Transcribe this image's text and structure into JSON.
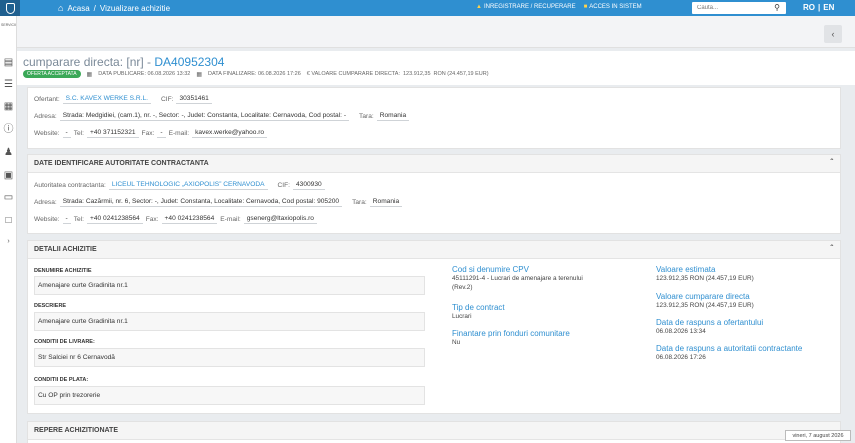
{
  "topbar": {
    "breadcrumb": [
      "Acasa",
      "/",
      "Vizualizare achizitie"
    ],
    "links": [
      "INREGISTRARE / RECUPERARE",
      "ACCES IN SISTEM"
    ],
    "search_placeholder": "Cauta...",
    "lang": [
      "RO",
      "|",
      "EN"
    ]
  },
  "sidebar": {
    "label": "SERVICII"
  },
  "header": {
    "title_prefix": "cumparare directa: [nr] -",
    "code": "DA40952304",
    "status": "OFERTA ACCEPTATA",
    "publish": "DATA PUBLICARE: 06.08.2026 13:32",
    "finalize": "DATA FINALIZARE: 06.08.2026 17:26",
    "value_label": "€ VALOARE CUMPARARE DIRECTA:",
    "value": "123.912,35",
    "value_unit": "RON (24.457,19 EUR)"
  },
  "ofertant": {
    "label": "Ofertant:",
    "name": "S.C. KAVEX WERKE S.R.L.",
    "cif_label": "CIF:",
    "cif": "30351461",
    "address_label": "Adresa:",
    "address": "Strada: Medgidiei, (cam.1), nr. -, Sector: -, Judet: Constanta, Localitate: Cernavoda, Cod postal: -",
    "country_label": "Tara:",
    "country": "Romania",
    "website_label": "Website:",
    "website": "-",
    "tel_label": "Tel:",
    "tel": "+40 371152321",
    "fax_label": "Fax:",
    "fax": "-",
    "email_label": "E-mail:",
    "email": "kavex.werke@yahoo.ro"
  },
  "authority": {
    "heading": "DATE IDENTIFICARE AUTORITATE CONTRACTANTA",
    "label": "Autoritatea contractanta:",
    "name": "LICEUL TEHNOLOGIC „AXIOPOLIS” CERNAVODA",
    "cif_label": "CIF:",
    "cif": "4300930",
    "address_label": "Adresa:",
    "address": "Strada: Cazărmii, nr. 6, Sector: -, Judet: Constanta, Localitate: Cernavoda, Cod postal: 905200",
    "country_label": "Tara:",
    "country": "Romania",
    "website_label": "Website:",
    "website": "-",
    "tel_label": "Tel:",
    "tel": "+40 0241238564",
    "fax_label": "Fax:",
    "fax": "+40 0241238564",
    "email_label": "E-mail:",
    "email": "gsenerg@ltaxiopolis.ro"
  },
  "details": {
    "heading": "DETALII ACHIZITIE",
    "name_label": "DENUMIRE ACHIZITIE",
    "name": "Amenajare curte Gradinita nr.1",
    "desc_label": "DESCRIERE",
    "desc": "Amenajare curte Gradinita nr.1",
    "delivery_label": "CONDITII DE LIVRARE:",
    "delivery": "Str Salciei nr 6 Cernavodă",
    "payment_label": "CONDITII DE PLATA:",
    "payment": "Cu OP prin trezorerie",
    "cpv_label": "Cod si denumire CPV",
    "cpv_line1": "45111291-4 - Lucrari de amenajare a terenului",
    "cpv_line2": "(Rev.2)",
    "contract_label": "Tip de contract",
    "contract": "Lucrari",
    "funds_label": "Finantare prin fonduri comunitare",
    "funds": "Nu",
    "est_label": "Valoare estimata",
    "est": "123.912,35 RON (24.457,19 EUR)",
    "buy_label": "Valoare cumparare directa",
    "buy": "123.912,35 RON (24.457,19 EUR)",
    "resp_off_label": "Data de raspuns a ofertantului",
    "resp_off": "06.08.2026 13:34",
    "resp_auth_label": "Data de raspuns a autoritatii contractante",
    "resp_auth": "06.08.2026 17:26"
  },
  "repere": {
    "heading": "REPERE ACHIZITIONATE"
  },
  "footer_date": "vineri, 7 august 2026"
}
